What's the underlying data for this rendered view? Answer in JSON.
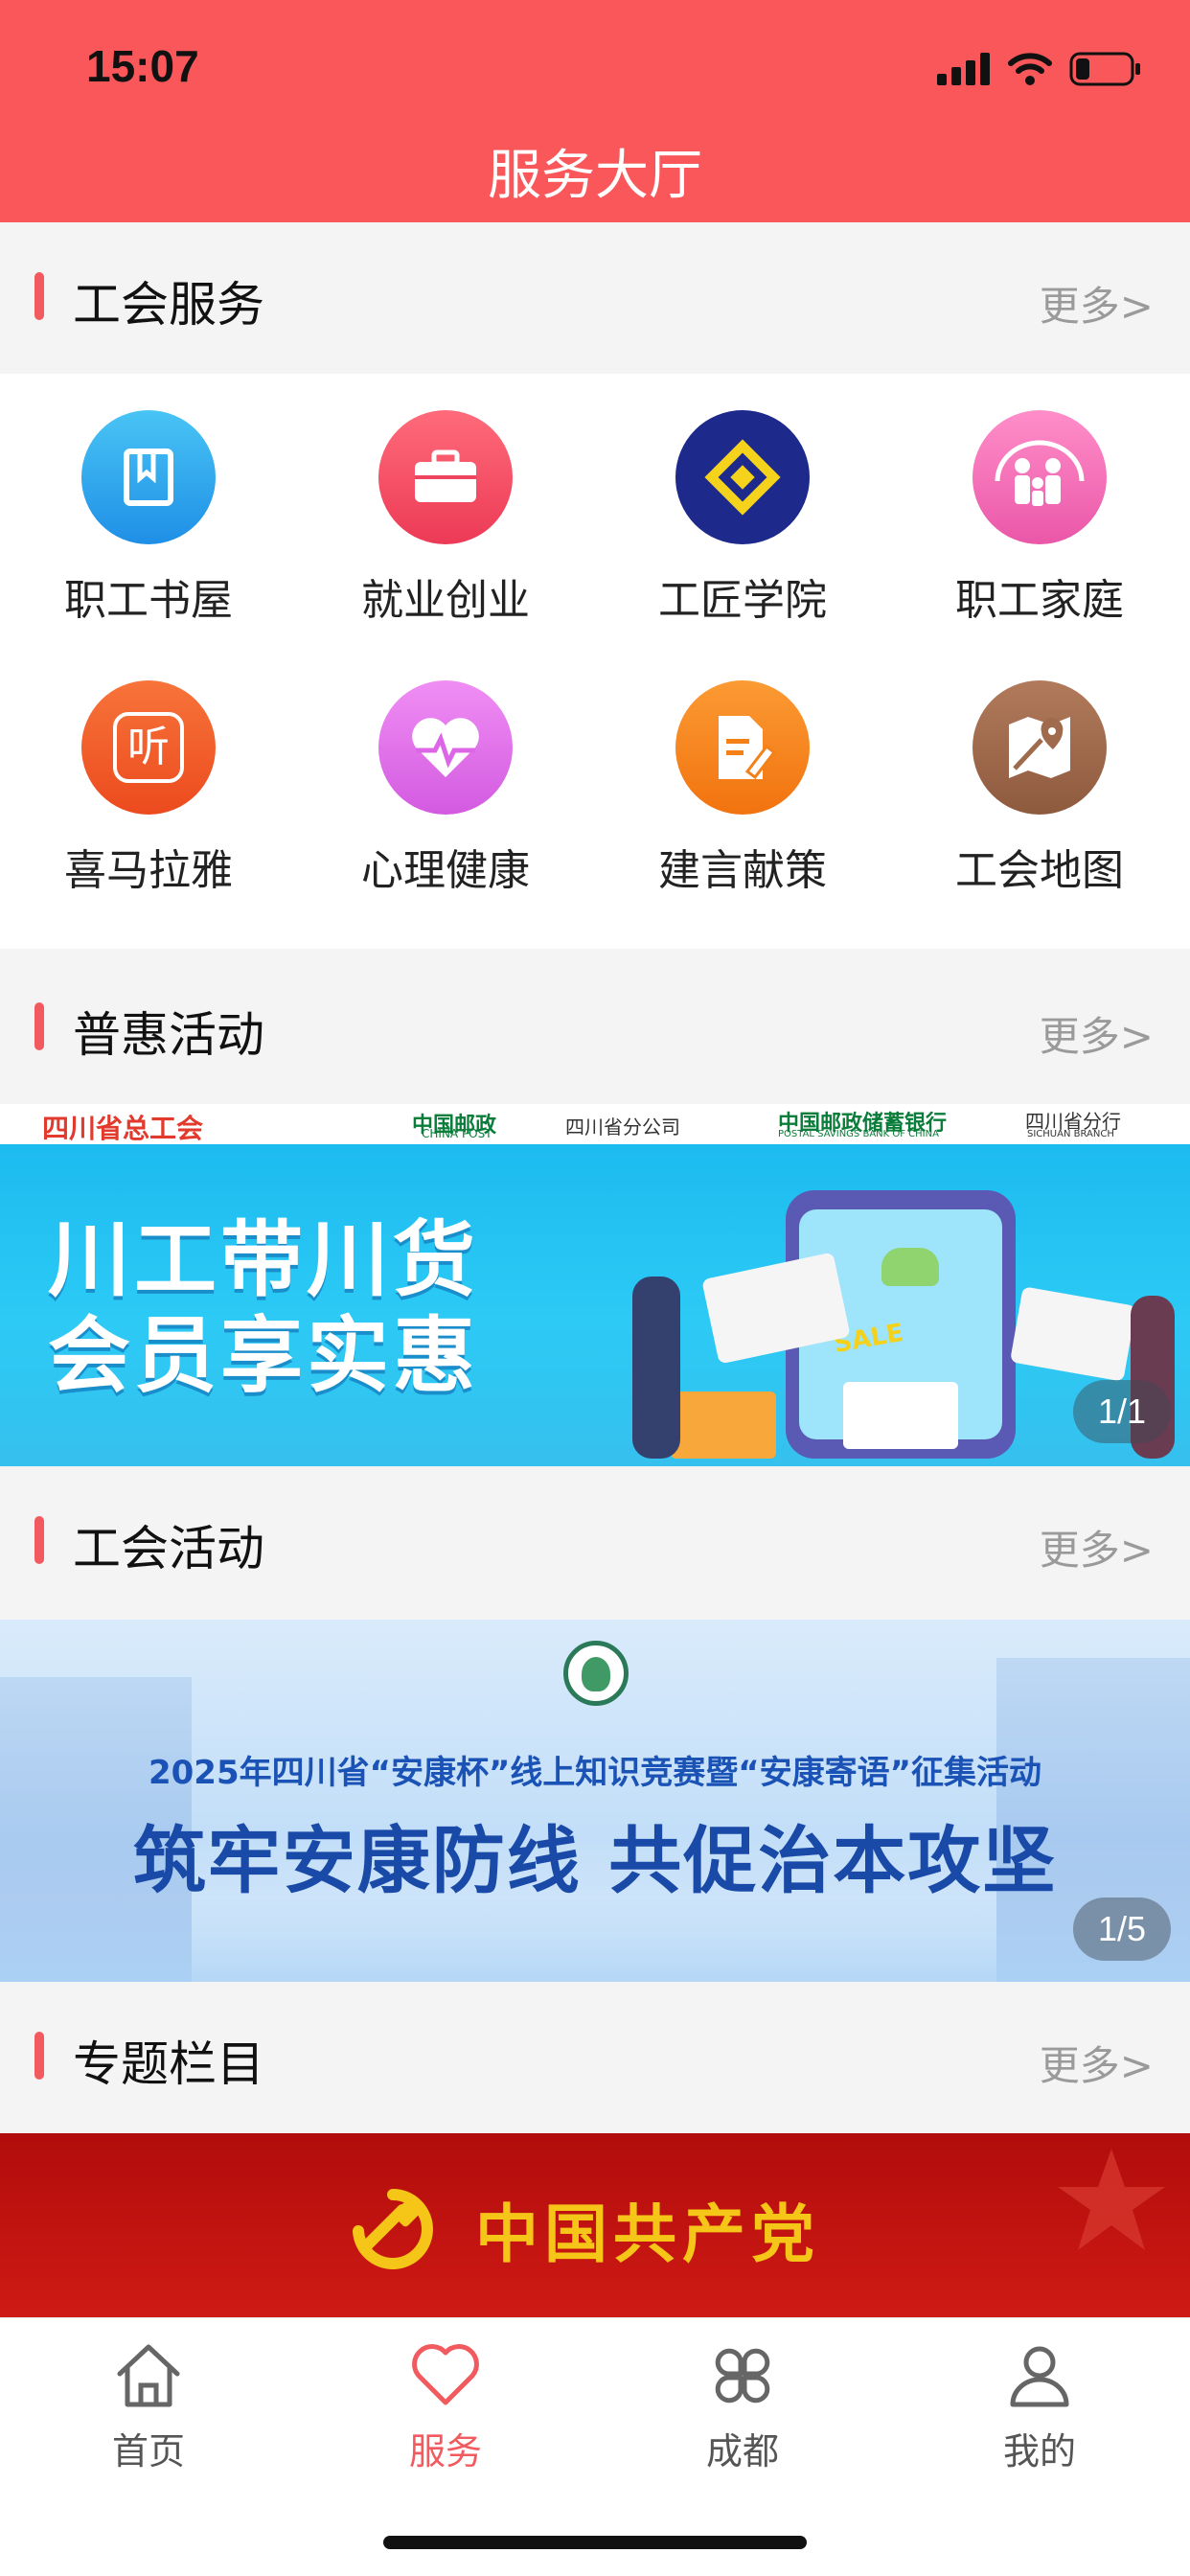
{
  "status_bar": {
    "time": "15:07"
  },
  "header": {
    "title": "服务大厅"
  },
  "sections": {
    "union_services": {
      "title": "工会服务",
      "more": "更多>"
    },
    "benefits": {
      "title": "普惠活动",
      "more": "更多>"
    },
    "union_activities": {
      "title": "工会活动",
      "more": "更多>"
    },
    "special_topics": {
      "title": "专题栏目",
      "more": "更多>"
    }
  },
  "services": [
    {
      "label": "职工书屋",
      "icon": "book-icon",
      "color": "#2fa7ec"
    },
    {
      "label": "就业创业",
      "icon": "briefcase-icon",
      "color": "#f14d62"
    },
    {
      "label": "工匠学院",
      "icon": "craftsman-logo-icon",
      "color": "#1d2a8c"
    },
    {
      "label": "职工家庭",
      "icon": "family-icon",
      "color": "#f070b6"
    },
    {
      "label": "喜马拉雅",
      "icon": "listen-icon",
      "color": "#f2602c"
    },
    {
      "label": "心理健康",
      "icon": "heart-pulse-icon",
      "color": "#e06ee6"
    },
    {
      "label": "建言献策",
      "icon": "document-edit-icon",
      "color": "#f7821c"
    },
    {
      "label": "工会地图",
      "icon": "map-pin-icon",
      "color": "#a0694c"
    }
  ],
  "benefit_banner": {
    "top_org_1": "四川省总工会",
    "top_org_2": "中国邮政",
    "top_org_2_en": "CHINA POST",
    "top_org_2_branch": "四川省分公司",
    "top_org_3": "中国邮政储蓄银行",
    "top_org_3_en": "POSTAL SAVINGS BANK OF CHINA",
    "top_org_3_branch": "四川省分行",
    "top_org_3_branch_en": "SICHUAN BRANCH",
    "headline_1": "川工带川货",
    "headline_2": "会员享实惠",
    "sale_tag": "SALE",
    "counter": "1/1"
  },
  "activity_banner": {
    "subtitle": "2025年四川省“安康杯”线上知识竞赛暨“安康寄语”征集活动",
    "headline": "筑牢安康防线 共促治本攻坚",
    "counter": "1/5"
  },
  "topic_banner": {
    "headline": "中国共产党"
  },
  "tabbar": [
    {
      "label": "首页",
      "icon": "home-icon",
      "active": false
    },
    {
      "label": "服务",
      "icon": "heart-icon",
      "active": true
    },
    {
      "label": "成都",
      "icon": "grid-icon",
      "active": false
    },
    {
      "label": "我的",
      "icon": "profile-icon",
      "active": false
    }
  ],
  "colors": {
    "header": "#f9575a",
    "accent": "#f15a5e",
    "muted": "#9a9a9a"
  }
}
